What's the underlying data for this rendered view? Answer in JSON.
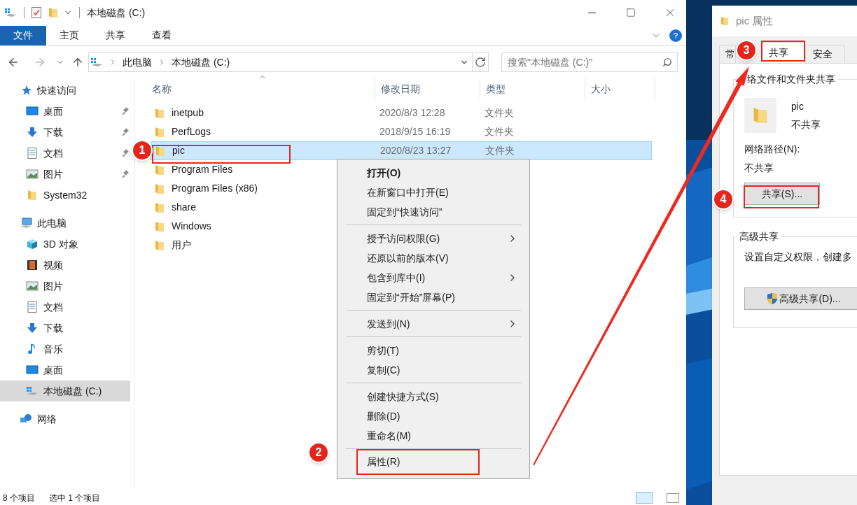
{
  "window": {
    "title": "本地磁盘 (C:)"
  },
  "ribbon_tabs": [
    {
      "label": "文件",
      "selected": true
    },
    {
      "label": "主页",
      "selected": false
    },
    {
      "label": "共享",
      "selected": false
    },
    {
      "label": "查看",
      "selected": false
    }
  ],
  "address_bar": {
    "crumbs": [
      "此电脑",
      "本地磁盘 (C:)"
    ]
  },
  "search": {
    "placeholder": "搜索\"本地磁盘 (C:)\""
  },
  "sidebar": [
    {
      "label": "快速访问",
      "kind": "star",
      "selected": false,
      "children": [
        {
          "label": "桌面",
          "kind": "desktop",
          "pinned": true,
          "selected": false
        },
        {
          "label": "下载",
          "kind": "download",
          "pinned": true,
          "selected": false
        },
        {
          "label": "文档",
          "kind": "document",
          "pinned": true,
          "selected": false
        },
        {
          "label": "图片",
          "kind": "pictures",
          "pinned": true,
          "selected": false
        },
        {
          "label": "System32",
          "kind": "folder",
          "pinned": false,
          "selected": false
        }
      ]
    },
    {
      "label": "此电脑",
      "kind": "computer",
      "selected": false,
      "children": [
        {
          "label": "3D 对象",
          "kind": "cube",
          "pinned": false,
          "selected": false
        },
        {
          "label": "视频",
          "kind": "video",
          "pinned": false,
          "selected": false
        },
        {
          "label": "图片",
          "kind": "pictures",
          "pinned": false,
          "selected": false
        },
        {
          "label": "文档",
          "kind": "document",
          "pinned": false,
          "selected": false
        },
        {
          "label": "下载",
          "kind": "download",
          "pinned": false,
          "selected": false
        },
        {
          "label": "音乐",
          "kind": "music",
          "pinned": false,
          "selected": false
        },
        {
          "label": "桌面",
          "kind": "desktop",
          "pinned": false,
          "selected": false
        },
        {
          "label": "本地磁盘 (C:)",
          "kind": "drive",
          "pinned": false,
          "selected": true
        }
      ]
    },
    {
      "label": "网络",
      "kind": "network",
      "selected": false
    }
  ],
  "table": {
    "columns": [
      "名称",
      "修改日期",
      "类型",
      "大小"
    ],
    "rows": [
      {
        "name": "inetpub",
        "modified": "2020/8/3 12:28",
        "type": "文件夹",
        "selected": false
      },
      {
        "name": "PerfLogs",
        "modified": "2018/9/15 16:19",
        "type": "文件夹",
        "selected": false
      },
      {
        "name": "pic",
        "modified": "2020/8/23 13:27",
        "type": "文件夹",
        "selected": true
      },
      {
        "name": "Program Files",
        "selected": false
      },
      {
        "name": "Program Files (x86)",
        "selected": false
      },
      {
        "name": "share",
        "selected": false
      },
      {
        "name": "Windows",
        "selected": false
      },
      {
        "name": "用户",
        "selected": false
      }
    ]
  },
  "context_menu": [
    [
      {
        "label": "打开(O)",
        "default": true,
        "submenu": false
      },
      {
        "label": "在新窗口中打开(E)",
        "default": false,
        "submenu": false
      },
      {
        "label": "固定到“快速访问”",
        "default": false,
        "submenu": false
      }
    ],
    [
      {
        "label": "授予访问权限(G)",
        "default": false,
        "submenu": true
      },
      {
        "label": "还原以前的版本(V)",
        "default": false,
        "submenu": false
      },
      {
        "label": "包含到库中(I)",
        "default": false,
        "submenu": true
      },
      {
        "label": "固定到“开始”屏幕(P)",
        "default": false,
        "submenu": false
      }
    ],
    [
      {
        "label": "发送到(N)",
        "default": false,
        "submenu": true
      }
    ],
    [
      {
        "label": "剪切(T)",
        "default": false,
        "submenu": false
      },
      {
        "label": "复制(C)",
        "default": false,
        "submenu": false
      }
    ],
    [
      {
        "label": "创建快捷方式(S)",
        "default": false,
        "submenu": false
      },
      {
        "label": "删除(D)",
        "default": false,
        "submenu": false
      },
      {
        "label": "重命名(M)",
        "default": false,
        "submenu": false
      }
    ],
    [
      {
        "label": "属性(R)",
        "default": false,
        "submenu": false
      }
    ]
  ],
  "status_bar": [
    "8 个项目",
    "选中 1 个项目"
  ],
  "dialog": {
    "title": "pic 属性",
    "tabs": [
      {
        "label": "常",
        "selected": false
      },
      {
        "label": "共享",
        "selected": true
      },
      {
        "label": "安全",
        "selected": false
      }
    ],
    "network_sharing": {
      "title": "络文件和文件夹共享",
      "name": "pic",
      "state": "不共享",
      "path_label": "网络路径(N):",
      "path": "不共享",
      "button": "共享(S)..."
    },
    "advanced_sharing": {
      "title": "高级共享",
      "text": "设置自定义权限，创建多",
      "button": "高级共享(D)..."
    }
  },
  "annotations": [
    {
      "label": "1"
    },
    {
      "label": "2"
    },
    {
      "label": "3"
    },
    {
      "label": "4"
    }
  ]
}
